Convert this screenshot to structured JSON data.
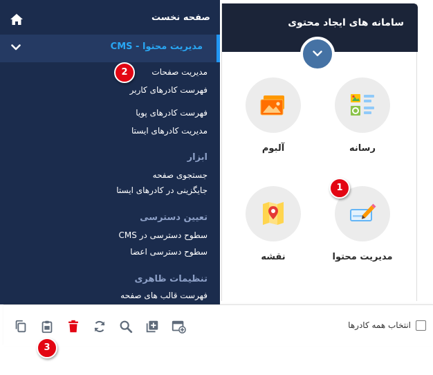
{
  "colors": {
    "menu_bg": "#1b2c4d",
    "menu_active_bg": "#253a63",
    "accent_blue": "#2196f3",
    "panel_header_bg": "#1b2438",
    "delete_red": "#e30613",
    "icon_gray": "#5f6b7a"
  },
  "sidebar": {
    "home_label": "صفحه نخست",
    "home_icon": "home-icon",
    "cms_label": "مدیریت محتوا - CMS",
    "cms_icon": "chevron-down-icon",
    "groups": [
      {
        "header": "",
        "items": [
          "مدیریت صفحات",
          "فهرست کادرهای کاربر",
          "فهرست کادرهای پویا",
          "مدیریت کادرهای ایستا"
        ]
      },
      {
        "header": "ابزار",
        "items": [
          "جستجوی صفحه",
          "جایگزینی در کادرهای ایستا"
        ]
      },
      {
        "header": "تعیین دسترسی",
        "items": [
          "سطوح دسترسی در CMS",
          "سطوح دسترسی اعضا"
        ]
      },
      {
        "header": "تنظیمات ظاهری",
        "items": [
          "فهرست قالب های صفحه"
        ]
      }
    ]
  },
  "panel": {
    "title": "سامانه های ایجاد محتوی",
    "toggle_icon": "chevron-down-icon",
    "tiles": [
      {
        "label": "رسانه",
        "icon": "media-icon"
      },
      {
        "label": "آلبوم",
        "icon": "album-icon"
      },
      {
        "label": "مدیریت محتوا",
        "icon": "content-edit-icon"
      },
      {
        "label": "نقشه",
        "icon": "map-icon"
      }
    ]
  },
  "toolbar": {
    "select_all_label": "انتخاب همه کادرها",
    "icons": [
      "copy-icon",
      "paste-icon",
      "delete-icon",
      "refresh-icon",
      "search-icon",
      "add-box-icon",
      "add-layout-icon"
    ]
  },
  "badges": [
    "1",
    "2",
    "3"
  ]
}
